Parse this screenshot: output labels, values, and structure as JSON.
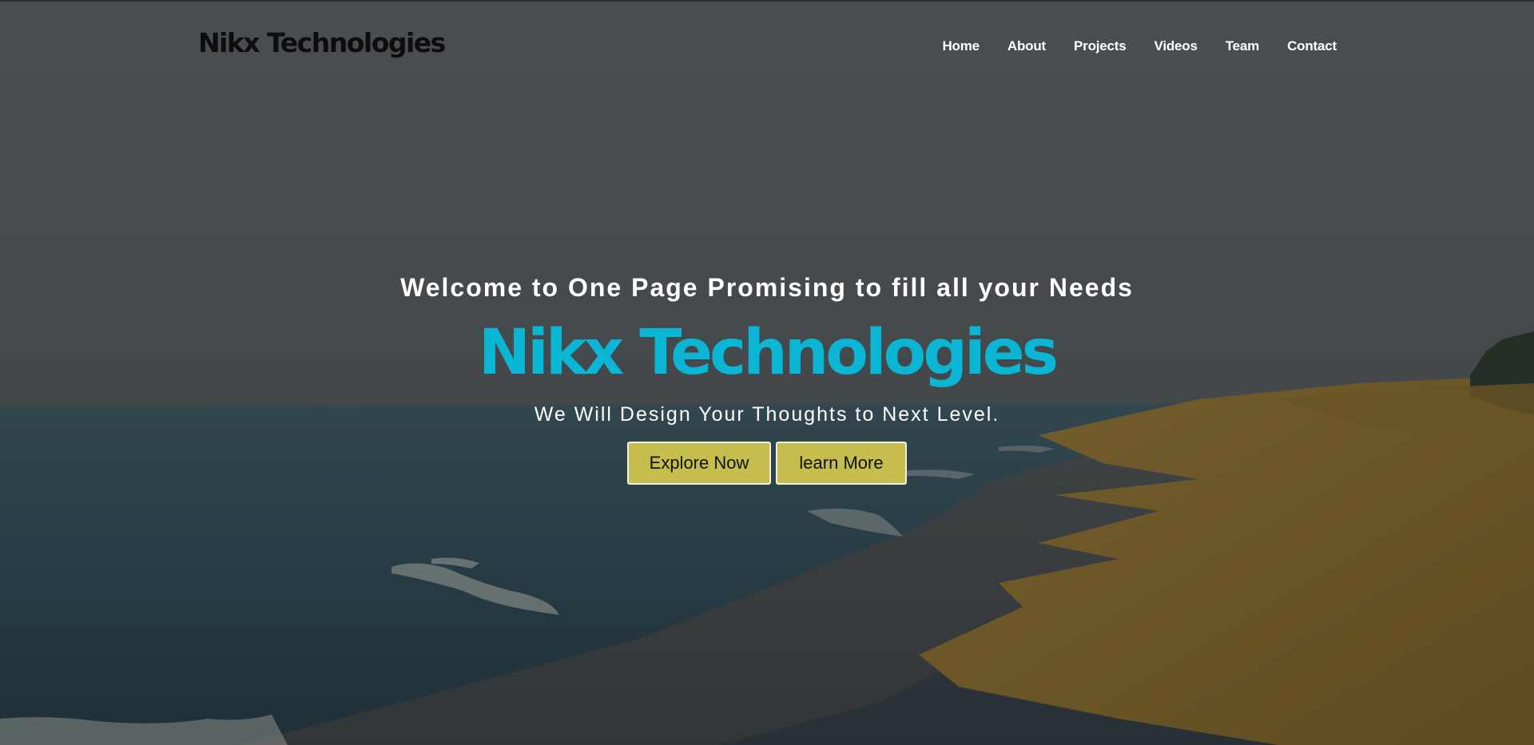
{
  "navbar": {
    "logo": "Nikx Technologies",
    "links": [
      "Home",
      "About",
      "Projects",
      "Videos",
      "Team",
      "Contact"
    ]
  },
  "hero": {
    "welcome": "Welcome to One Page Promising to fill all your Needs",
    "title": "Nikx Technologies",
    "tagline": "We Will Design Your Thoughts to Next Level.",
    "buttons": {
      "explore": "Explore Now",
      "learn": "learn More"
    }
  },
  "colors": {
    "title_accent": "#0ab6d3",
    "button_bg": "#c6bd4f"
  },
  "background": "beach-sea-shore-photo"
}
